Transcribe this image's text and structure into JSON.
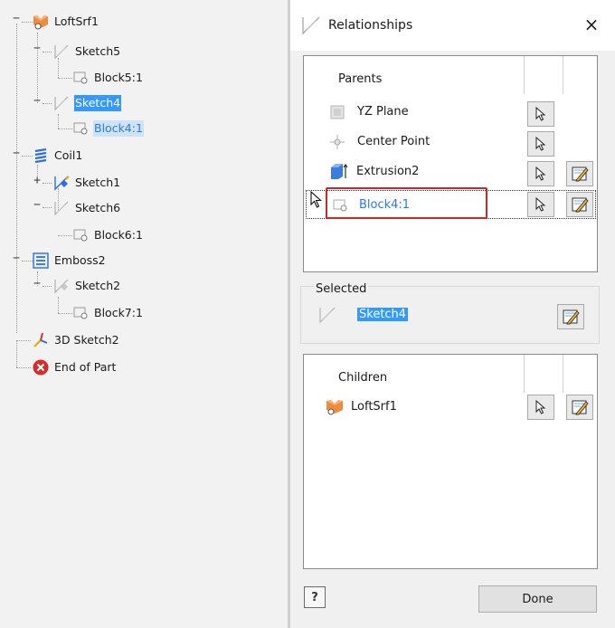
{
  "browser": {
    "items": [
      {
        "label": "LoftSrf1",
        "icon": "loft-surface-icon"
      },
      {
        "label": "Sketch5",
        "icon": "sketch-icon"
      },
      {
        "label": "Block5:1",
        "icon": "sketch-block-icon"
      },
      {
        "label": "Sketch4",
        "icon": "sketch-icon"
      },
      {
        "label": "Block4:1",
        "icon": "sketch-block-icon"
      },
      {
        "label": "Coil1",
        "icon": "coil-icon"
      },
      {
        "label": "Sketch1",
        "icon": "shared-sketch-icon"
      },
      {
        "label": "Sketch6",
        "icon": "sketch-icon"
      },
      {
        "label": "Block6:1",
        "icon": "sketch-block-icon"
      },
      {
        "label": "Emboss2",
        "icon": "emboss-icon"
      },
      {
        "label": "Sketch2",
        "icon": "sketch-icon"
      },
      {
        "label": "Block7:1",
        "icon": "sketch-block-icon"
      },
      {
        "label": "3D Sketch2",
        "icon": "3d-sketch-icon"
      },
      {
        "label": "End of Part",
        "icon": "end-of-part-icon"
      }
    ]
  },
  "dialog": {
    "title": "Relationships",
    "close_glyph": "×",
    "parents": {
      "header": "Parents",
      "rows": [
        {
          "label": "YZ Plane",
          "icon": "work-plane-icon"
        },
        {
          "label": "Center Point",
          "icon": "center-point-icon"
        },
        {
          "label": "Extrusion2",
          "icon": "extrusion-icon"
        },
        {
          "label": "Block4:1",
          "icon": "sketch-block-icon"
        }
      ]
    },
    "selected": {
      "header": "Selected",
      "label": "Sketch4"
    },
    "children": {
      "header": "Children",
      "rows": [
        {
          "label": "LoftSrf1",
          "icon": "loft-surface-icon"
        }
      ]
    },
    "help_glyph": "?",
    "done_label": "Done"
  },
  "colors": {
    "selection": "#3399ff",
    "highlight_box": "#d0262b",
    "tree_background": "#f2f2f2",
    "dialog_background": "#f0f0f0"
  }
}
